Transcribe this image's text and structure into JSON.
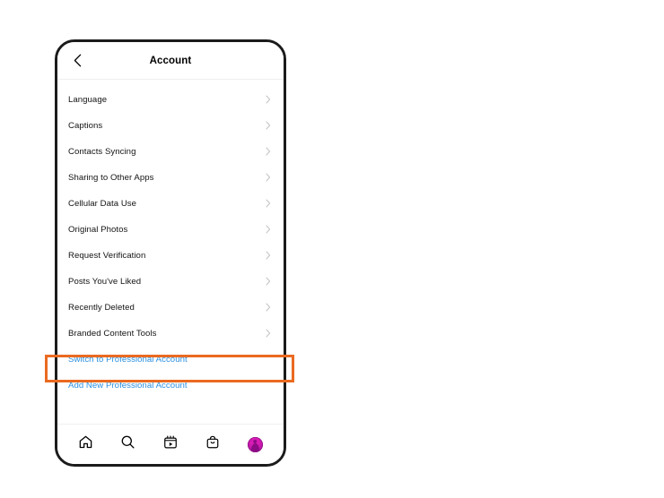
{
  "canvas": {
    "background_color": "#ffffff"
  },
  "device": {
    "frame_color": "#1b1b1b",
    "screen_background": "#ffffff"
  },
  "app_header": {
    "title": "Account",
    "back_icon": "chevron-left-icon"
  },
  "settings_list": {
    "rows": [
      {
        "label": "Language",
        "accessory": "chevron-right-icon"
      },
      {
        "label": "Captions",
        "accessory": "chevron-right-icon"
      },
      {
        "label": "Contacts Syncing",
        "accessory": "chevron-right-icon"
      },
      {
        "label": "Sharing to Other Apps",
        "accessory": "chevron-right-icon"
      },
      {
        "label": "Cellular Data Use",
        "accessory": "chevron-right-icon"
      },
      {
        "label": "Original Photos",
        "accessory": "chevron-right-icon"
      },
      {
        "label": "Request Verification",
        "accessory": "chevron-right-icon"
      },
      {
        "label": "Posts You've Liked",
        "accessory": "chevron-right-icon"
      },
      {
        "label": "Recently Deleted",
        "accessory": "chevron-right-icon"
      },
      {
        "label": "Branded Content Tools",
        "accessory": "chevron-right-icon"
      }
    ],
    "link_rows": [
      {
        "label": "Switch to Professional Account",
        "color": "#2a8fe0",
        "highlighted": true
      },
      {
        "label": "Add New Professional Account",
        "color": "#2a8fe0",
        "highlighted": false
      }
    ]
  },
  "bottom_nav": {
    "items": [
      {
        "name": "home-icon",
        "label": "Home"
      },
      {
        "name": "search-icon",
        "label": "Search"
      },
      {
        "name": "reels-icon",
        "label": "Reels"
      },
      {
        "name": "shop-bag-icon",
        "label": "Shop"
      },
      {
        "name": "profile-avatar",
        "label": "Profile"
      }
    ]
  },
  "annotation": {
    "highlight_color": "#ea6a21",
    "highlight_target": "Switch to Professional Account"
  }
}
